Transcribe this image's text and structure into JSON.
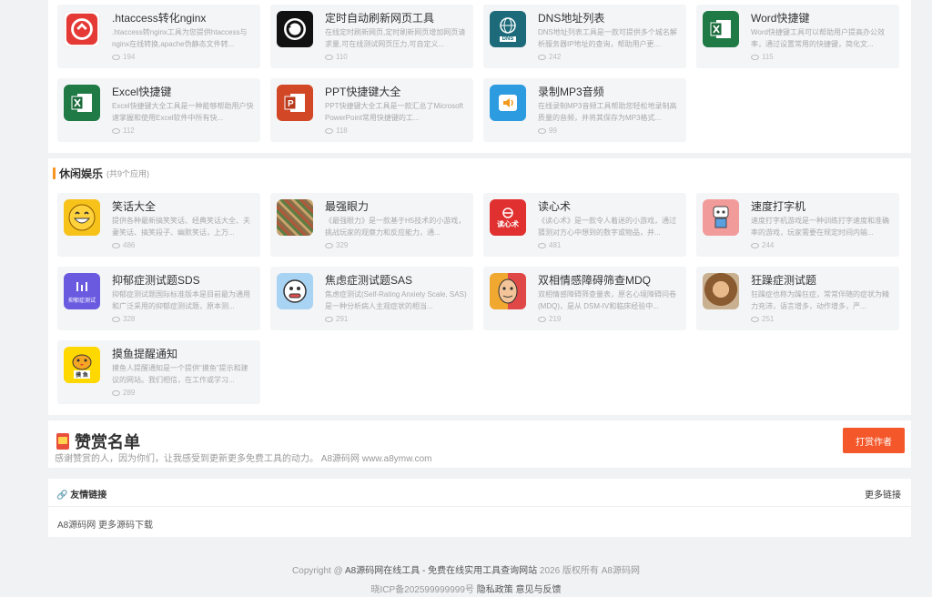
{
  "top_cards": [
    {
      "title": ".htaccess转化nginx",
      "desc": ".htaccess转nginx工具为您提供htaccess与nginx在线转换,apache伪静态文件转...",
      "views": "194",
      "icon": "htaccess-icon",
      "color": "#e53935"
    },
    {
      "title": "定时自动刷新网页工具",
      "desc": "在线定时刷新网页,定时刷新网页增加网页请求量,可在线测试网页压力,可自定义...",
      "views": "110",
      "icon": "refresh-icon",
      "color": "#111111"
    },
    {
      "title": "DNS地址列表",
      "desc": "DNS地址列表工具是一款可提供多个城名解析服务器IP地址的查询，帮助用户更...",
      "views": "242",
      "icon": "dns-icon",
      "color": "#1d6b7a"
    },
    {
      "title": "Word快捷键",
      "desc": "Word快捷键工具可以帮助用户提高办公效率，通过设置常用的快捷键，简化文...",
      "views": "115",
      "icon": "excel-icon",
      "color": "#1f7a45"
    },
    {
      "title": "Excel快捷键",
      "desc": "Excel快捷键大全工具是一种能够帮助用户快速掌握和使用Excel软件中所有快...",
      "views": "112",
      "icon": "excel-icon",
      "color": "#1f7a45"
    },
    {
      "title": "PPT快捷键大全",
      "desc": "PPT快捷键大全工具是一款汇总了Microsoft PowerPoint常用快捷键的工...",
      "views": "118",
      "icon": "ppt-icon",
      "color": "#d24726"
    },
    {
      "title": "录制MP3音频",
      "desc": "在线录制MP3音频工具帮助您轻松地录制高质量的音频，并将其保存为MP3格式...",
      "views": "99",
      "icon": "speaker-icon",
      "color": "#2d9be0"
    }
  ],
  "section": {
    "title": "休闲娱乐",
    "count": "(共9个应用)"
  },
  "leisure_cards": [
    {
      "title": "笑话大全",
      "desc": "提供各种最新搞笑笑话、经典笑话大全、夫妻笑话、搞笑段子、幽默笑话，上万...",
      "views": "486",
      "icon": "smile-icon",
      "color": "#f7c21a"
    },
    {
      "title": "最强眼力",
      "desc": "《最强眼力》是一款基于H5技术的小游戏，挑战玩家的观察力和反应能力，通...",
      "views": "329",
      "icon": "pixel-grid-icon",
      "color": "#8a6d4a"
    },
    {
      "title": "读心术",
      "desc": "《读心术》是一款令人着迷的小游戏，通过猜测对方心中想到的数字或物品，并...",
      "views": "481",
      "icon": "mind-read-icon",
      "color": "#e03030",
      "badge": "读心术"
    },
    {
      "title": "速度打字机",
      "desc": "速度打字机游戏是一种训练打字速度和准确率的游戏，玩家需要在规定时间内输...",
      "views": "244",
      "icon": "typing-robot-icon",
      "color": "#f29b9b"
    },
    {
      "title": "抑郁症测试题SDS",
      "desc": "抑郁症测试题国际标准版本是目前最为通用和广泛采用的抑郁症测试题，原本测...",
      "views": "328",
      "icon": "depression-test-icon",
      "color": "#6a5ae0",
      "badge": "抑郁症测试"
    },
    {
      "title": "焦虑症测试题SAS",
      "desc": "焦虑症测试(Self-Rating Anxiety Scale, SAS) 是一种分析病人主观症状的相当...",
      "views": "291",
      "icon": "anxiety-face-icon",
      "color": "#7fb6e0"
    },
    {
      "title": "双相情感障碍筛查MDQ",
      "desc": "双相情感障碍筛查量表，原名心境障碍问卷(MDQ)，是从 DSM-IV和临床经验中...",
      "views": "219",
      "icon": "bipolar-face-icon",
      "color": "#f0a830"
    },
    {
      "title": "狂躁症测试题",
      "desc": "狂躁症也称为躁狂症，常常伴随的症状为精力充沛，语言增多，动作增多，严...",
      "views": "251",
      "icon": "mania-photo-icon",
      "color": "#b07040"
    },
    {
      "title": "摸鱼提醒通知",
      "desc": "摸鱼人提醒通知是一个提供\"摸鱼\"提示和建议的网站。我们相信，在工作或学习...",
      "views": "289",
      "icon": "fish-chick-icon",
      "color": "#ffd800",
      "badge": "摸 鱼"
    }
  ],
  "reward": {
    "title": "赞赏名单",
    "subtitle": "感谢赞赏的人，因为你们，让我感受到更新更多免费工具的动力。 A8源码网 www.a8ymw.com",
    "button": "打赏作者"
  },
  "links": {
    "title": "友情链接",
    "more": "更多链接",
    "items": "A8源码网 更多源码下载"
  },
  "footer": {
    "copyright_prefix": "Copyright @",
    "site_link": "A8源码网在线工具 - 免费在线实用工具查询网站",
    "copyright_suffix": "2026 版权所有 A8源码网",
    "icp": "晓ICP备202599999999号",
    "privacy": "隐私政策",
    "feedback": "意见与反馈"
  }
}
